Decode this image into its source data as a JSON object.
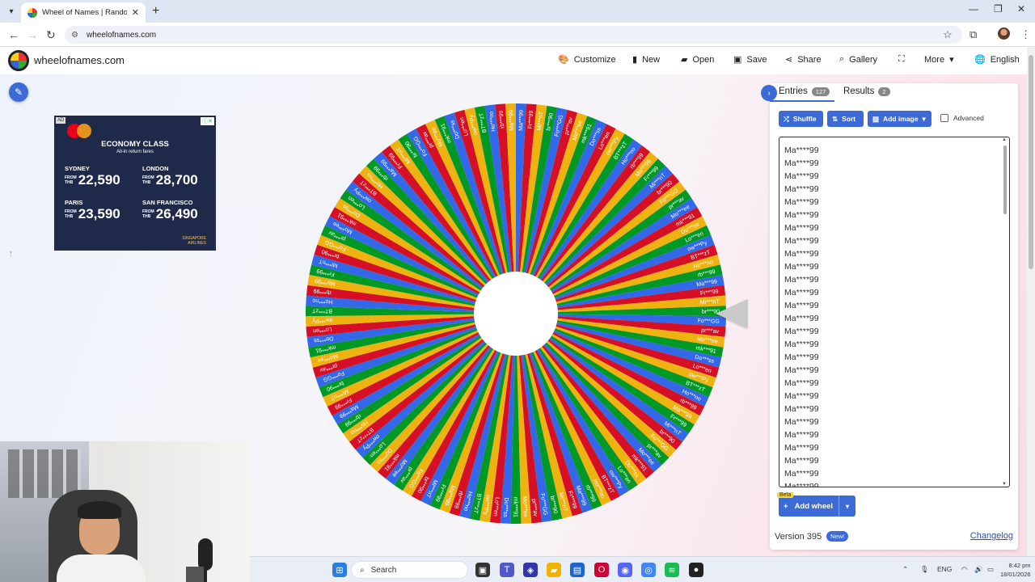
{
  "browser": {
    "tab_title": "Wheel of Names | Random nam",
    "url": "wheelofnames.com"
  },
  "header": {
    "site_name": "wheelofnames.com",
    "menu": [
      {
        "label": "Customize",
        "icon": "palette-icon"
      },
      {
        "label": "New",
        "icon": "new-file-icon"
      },
      {
        "label": "Open",
        "icon": "folder-icon"
      },
      {
        "label": "Save",
        "icon": "save-icon"
      },
      {
        "label": "Share",
        "icon": "share-icon"
      },
      {
        "label": "Gallery",
        "icon": "search-icon"
      },
      {
        "label": "",
        "icon": "fullscreen-icon"
      },
      {
        "label": "More",
        "icon": "chevron-down-icon"
      },
      {
        "label": "English",
        "icon": "globe-icon"
      }
    ]
  },
  "ad": {
    "tag": "AD",
    "headline": "ECONOMY CLASS",
    "subhead": "All-in return fares",
    "fares": [
      {
        "city": "SYDNEY",
        "currency_from": "FROM",
        "currency": "THB",
        "price": "22,590"
      },
      {
        "city": "LONDON",
        "currency_from": "FROM",
        "currency": "THB",
        "price": "28,700"
      },
      {
        "city": "PARIS",
        "currency_from": "FROM",
        "currency": "THB",
        "price": "23,590"
      },
      {
        "city": "SAN FRANCISCO",
        "currency_from": "FROM",
        "currency": "THB",
        "price": "26,490"
      }
    ],
    "airline_line1": "SINGAPORE",
    "airline_line2": "AIRLINES"
  },
  "wheel": {
    "segment_count": 127,
    "colors": [
      "#3369e8",
      "#d50f25",
      "#eeb211",
      "#009925"
    ],
    "label_samples_right": [
      "Ma***99",
      "Fr***99",
      "Mi***nT",
      "br***90",
      "Fo***GG",
      "pr***av",
      "Mo***ee",
      "mk***91",
      "Do***ss",
      "Lo***en"
    ],
    "label_samples_left": [
      "ow***Py",
      "BT***zT",
      "Ho***no",
      "rb***99"
    ]
  },
  "panel": {
    "tabs": [
      {
        "label": "Entries",
        "count": "127"
      },
      {
        "label": "Results",
        "count": "2"
      }
    ],
    "buttons": {
      "shuffle": "Shuffle",
      "sort": "Sort",
      "add_image": "Add image",
      "advanced": "Advanced"
    },
    "entries": [
      "Ma****99",
      "Ma****99",
      "Ma****99",
      "Ma****99",
      "Ma****99",
      "Ma****99",
      "Ma****99",
      "Ma****99",
      "Ma****99",
      "Ma****99",
      "Ma****99",
      "Ma****99",
      "Ma****99",
      "Ma****99",
      "Ma****99",
      "Ma****99",
      "Ma****99",
      "Ma****99",
      "Ma****99",
      "Ma****99",
      "Ma****99",
      "Ma****99",
      "Ma****99",
      "Ma****99",
      "Ma****99",
      "Ma****99",
      "Ma****99"
    ],
    "beta": "Beta",
    "add_wheel": "Add wheel",
    "version": "Version 395",
    "new_badge": "New!",
    "changelog": "Changelog"
  },
  "taskbar": {
    "search": "Search",
    "lang": "ENG",
    "time": "8:42 pm",
    "date": "18/01/2026"
  }
}
